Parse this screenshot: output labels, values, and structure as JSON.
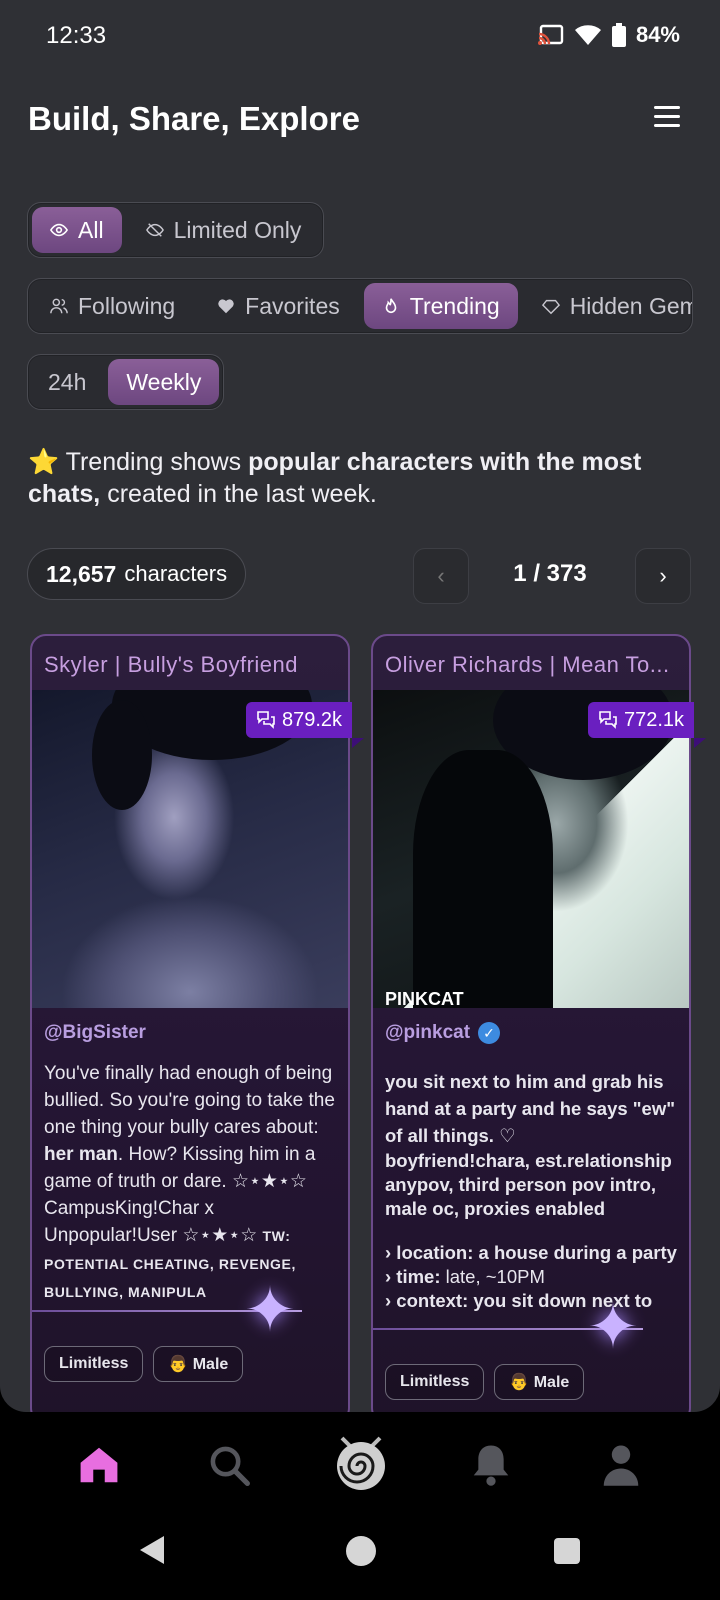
{
  "status": {
    "time": "12:33",
    "battery": "84%"
  },
  "header": {
    "title": "Build, Share, Explore"
  },
  "filters": {
    "visibility": [
      {
        "label": "All",
        "active": true,
        "icon": "eye-icon"
      },
      {
        "label": "Limited Only",
        "active": false,
        "icon": "eye-off-icon"
      }
    ],
    "feeds": [
      {
        "label": "Following",
        "active": false,
        "icon": "users-icon"
      },
      {
        "label": "Favorites",
        "active": false,
        "icon": "heart-icon"
      },
      {
        "label": "Trending",
        "active": true,
        "icon": "flame-icon"
      },
      {
        "label": "Hidden Gem",
        "active": false,
        "icon": "gem-icon"
      }
    ],
    "period": [
      {
        "label": "24h",
        "active": false
      },
      {
        "label": "Weekly",
        "active": true
      }
    ]
  },
  "info": {
    "emoji": "⭐",
    "prefix": " Trending shows ",
    "bold": "popular characters with the most chats,",
    "suffix": " created in the last week."
  },
  "results": {
    "count": "12,657",
    "count_label": "characters",
    "page": "1 / 373",
    "prev": "‹",
    "next": "›"
  },
  "cards": [
    {
      "title": "Skyler | Bully's Boyfriend",
      "chats": "879.2k",
      "creator": "@BigSister",
      "verified": false,
      "desc_a": "You've finally had enough of being bullied. So you're going to take the one thing your bully cares about: ",
      "desc_bold": "her man",
      "desc_b": ". How? Kissing him in a game of truth or dare. ☆⋆★⋆☆ CampusKing!Char x Unpopular!User ☆⋆★⋆☆ ",
      "desc_caps": "TW: POTENTIAL CHEATING, REVENGE, BULLYING, MANIPULA",
      "tags": [
        "Limitless",
        "👨 Male"
      ]
    },
    {
      "title": "Oliver Richards | Mean To...",
      "chats": "772.1k",
      "creator": "@pinkcat",
      "verified": true,
      "watermark": "PINKCAT",
      "desc_lines": [
        "you sit next to him and grab his hand at a party and he says \"ew\" of all things. ♡",
        "boyfriend!chara, est.relationship anypov, third person pov intro, male oc, proxies enabled"
      ],
      "details": [
        {
          "key": "› location:",
          "value": " a house during a party"
        },
        {
          "key": "› time:",
          "value": " late, ~10PM"
        },
        {
          "key": "› context:",
          "value": " you sit down next to"
        }
      ],
      "tags": [
        "Limitless",
        "👨 Male"
      ]
    }
  ],
  "nav": [
    "home-icon",
    "search-icon",
    "logo-icon",
    "bell-icon",
    "profile-icon"
  ],
  "colors": {
    "accent": "#7a4f8c",
    "stat": "#6a1fc0",
    "background": "#2f3035"
  }
}
